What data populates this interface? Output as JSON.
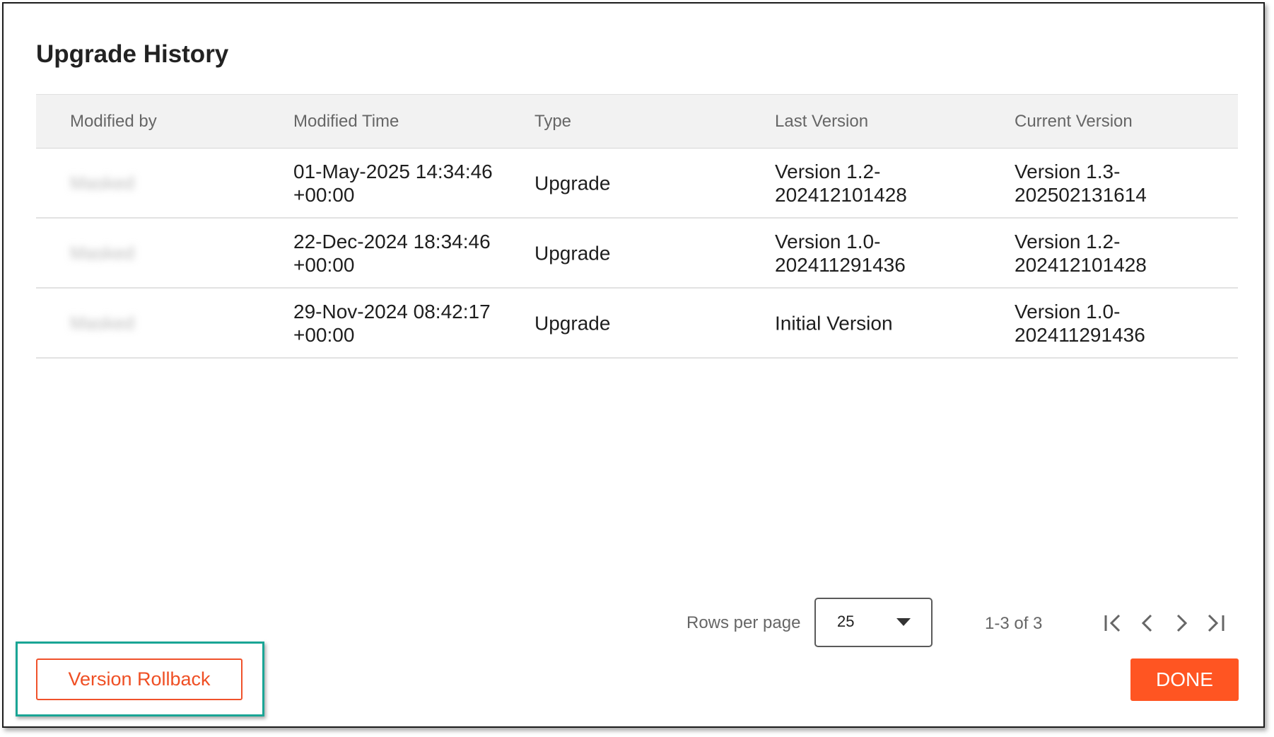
{
  "dialog": {
    "title": "Upgrade History"
  },
  "table": {
    "columns": [
      "Modified by",
      "Modified Time",
      "Type",
      "Last Version",
      "Current Version"
    ],
    "rows": [
      {
        "modified_by": "Masked",
        "time_line1": "01-May-2025 14:34:46",
        "time_line2": "+00:00",
        "type": "Upgrade",
        "last_line1": "Version 1.2-",
        "last_line2": "202412101428",
        "curr_line1": "Version 1.3-",
        "curr_line2": "202502131614"
      },
      {
        "modified_by": "Masked",
        "time_line1": "22-Dec-2024 18:34:46",
        "time_line2": "+00:00",
        "type": "Upgrade",
        "last_line1": "Version 1.0-",
        "last_line2": "202411291436",
        "curr_line1": "Version 1.2-",
        "curr_line2": "202412101428"
      },
      {
        "modified_by": "Masked",
        "time_line1": "29-Nov-2024 08:42:17",
        "time_line2": "+00:00",
        "type": "Upgrade",
        "last_line1": "Initial Version",
        "last_line2": "",
        "curr_line1": "Version 1.0-",
        "curr_line2": "202411291436"
      }
    ]
  },
  "pagination": {
    "rows_per_page_label": "Rows per page",
    "rows_per_page_value": "25",
    "range_text": "1-3 of 3",
    "icons": [
      "first-page-icon",
      "previous-page-icon",
      "next-page-icon",
      "last-page-icon"
    ]
  },
  "actions": {
    "rollback_label": "Version Rollback",
    "done_label": "DONE"
  },
  "colors": {
    "accent": "#ff5522",
    "highlight": "#1aa595",
    "header_bg": "#f2f2f2"
  }
}
